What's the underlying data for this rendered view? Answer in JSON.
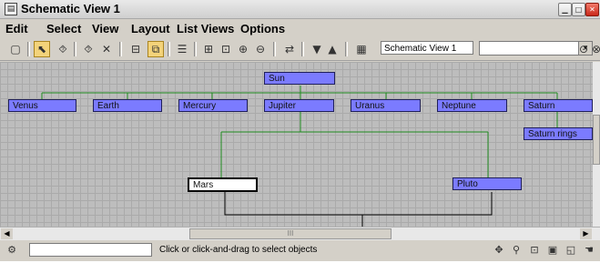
{
  "window": {
    "title": "Schematic View 1",
    "app_icon": "schematic-app-icon"
  },
  "menu": [
    "Edit",
    "Select",
    "View",
    "Layout",
    "List Views",
    "Options"
  ],
  "toolbar": {
    "buttons": [
      {
        "name": "display-floater-icon",
        "glyph": "▢"
      },
      {
        "name": "select-arrow-icon",
        "glyph": "⬉"
      },
      {
        "name": "connect-icon",
        "glyph": "⯑"
      },
      {
        "name": "unlink-icon",
        "glyph": "⯑"
      },
      {
        "name": "delete-icon",
        "glyph": "✕"
      },
      {
        "name": "hierarchy-mode-icon",
        "glyph": "⊟"
      },
      {
        "name": "references-mode-icon",
        "glyph": "⧉"
      },
      {
        "name": "arrange-children-icon",
        "glyph": "☰"
      },
      {
        "name": "arrange-selected-icon",
        "glyph": "⊞"
      },
      {
        "name": "free-all-icon",
        "glyph": "⊡"
      },
      {
        "name": "expand-selected-icon",
        "glyph": "⊕"
      },
      {
        "name": "collapse-selected-icon",
        "glyph": "⊖"
      },
      {
        "name": "preferences-icon",
        "glyph": "⇄"
      },
      {
        "name": "go-to-children-icon",
        "glyph": "▼"
      },
      {
        "name": "go-to-parent-icon",
        "glyph": "▲"
      },
      {
        "name": "bookmark-icon",
        "glyph": "▦"
      }
    ],
    "name_field_value": "Schematic View 1",
    "combo_value": "",
    "combo_arrow": "▾",
    "trailing_icons": [
      {
        "name": "bookmark-zoom-icon",
        "glyph": "⊙"
      },
      {
        "name": "delete-bookmark-icon",
        "glyph": "⊗"
      }
    ]
  },
  "nodes": [
    {
      "id": "sun",
      "label": "Sun"
    },
    {
      "id": "venus",
      "label": "Venus"
    },
    {
      "id": "earth",
      "label": "Earth"
    },
    {
      "id": "mercury",
      "label": "Mercury"
    },
    {
      "id": "jupiter",
      "label": "Jupiter"
    },
    {
      "id": "uranus",
      "label": "Uranus"
    },
    {
      "id": "neptune",
      "label": "Neptune"
    },
    {
      "id": "saturn",
      "label": "Saturn"
    },
    {
      "id": "saturn_rings",
      "label": "Saturn rings"
    },
    {
      "id": "mars",
      "label": "Mars",
      "selected": true
    },
    {
      "id": "pluto",
      "label": "Pluto"
    }
  ],
  "hscroll": {
    "left_arrow": "◀",
    "right_arrow": "▶",
    "grip": "III"
  },
  "status": {
    "icon": "tools-icon",
    "prompt_value": "",
    "message": "Click or click-and-drag to select objects"
  },
  "nav_icons": [
    {
      "name": "pan-icon",
      "glyph": "✥"
    },
    {
      "name": "zoom-icon",
      "glyph": "⚲"
    },
    {
      "name": "zoom-region-icon",
      "glyph": "⊡"
    },
    {
      "name": "zoom-extents-icon",
      "glyph": "▣"
    },
    {
      "name": "zoom-extents-selected-icon",
      "glyph": "◱"
    },
    {
      "name": "pan-hand-icon",
      "glyph": "☚"
    }
  ],
  "colors": {
    "node_fill": "#7b7bff",
    "link_color": "#1e8a1e",
    "selected_fill": "#ffffff"
  }
}
